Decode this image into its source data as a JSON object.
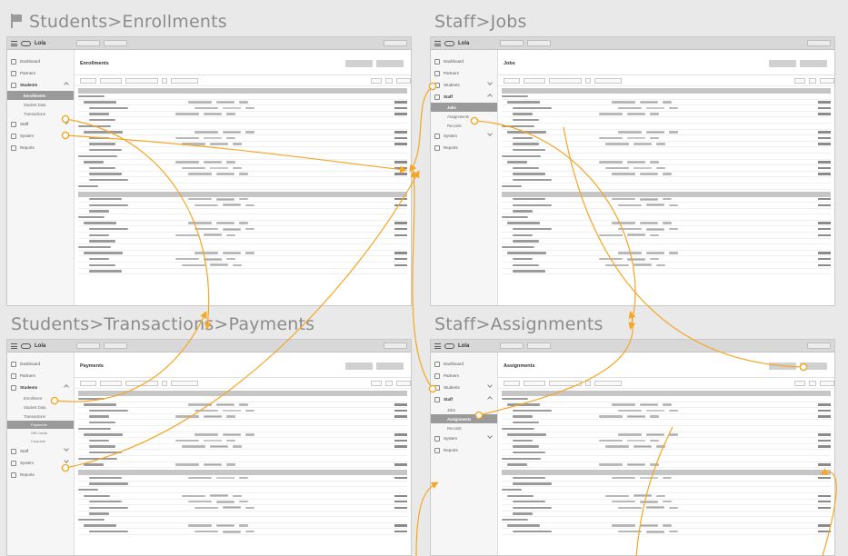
{
  "titles": {
    "enrollments": "Students>Enrollments",
    "jobs": "Staff>Jobs",
    "payments": "Students>Transactions>Payments",
    "assignments": "Staff>Assignments"
  },
  "app": {
    "brand": "Lola"
  },
  "screens": {
    "enrollments": {
      "page_title": "Enrollments",
      "sidebar": [
        {
          "type": "item",
          "label": "Dashboard"
        },
        {
          "type": "item",
          "label": "Partners"
        },
        {
          "type": "item",
          "label": "Students",
          "open": true
        },
        {
          "type": "sub",
          "label": "Enrollments",
          "active": true
        },
        {
          "type": "sub",
          "label": "Student Data"
        },
        {
          "type": "sub",
          "label": "Transactions"
        },
        {
          "type": "item",
          "label": "Staff"
        },
        {
          "type": "item",
          "label": "System"
        },
        {
          "type": "item",
          "label": "Reports"
        }
      ]
    },
    "jobs": {
      "page_title": "Jobs",
      "sidebar": [
        {
          "type": "item",
          "label": "Dashboard"
        },
        {
          "type": "item",
          "label": "Partners"
        },
        {
          "type": "item",
          "label": "Students"
        },
        {
          "type": "item",
          "label": "Staff",
          "open": true
        },
        {
          "type": "sub",
          "label": "Jobs",
          "active": true
        },
        {
          "type": "sub",
          "label": "Assignments"
        },
        {
          "type": "sub",
          "label": "Records"
        },
        {
          "type": "item",
          "label": "System"
        },
        {
          "type": "item",
          "label": "Reports"
        }
      ]
    },
    "payments": {
      "page_title": "Payments",
      "sidebar": [
        {
          "type": "item",
          "label": "Dashboard"
        },
        {
          "type": "item",
          "label": "Partners"
        },
        {
          "type": "item",
          "label": "Students",
          "open": true
        },
        {
          "type": "sub",
          "label": "Enrollment"
        },
        {
          "type": "sub",
          "label": "Student Data"
        },
        {
          "type": "sub",
          "label": "Transactions"
        },
        {
          "type": "subsub",
          "label": "Payments",
          "active": true
        },
        {
          "type": "subsub",
          "label": "Gift Cards"
        },
        {
          "type": "subsub",
          "label": "Coupons"
        },
        {
          "type": "item",
          "label": "Staff"
        },
        {
          "type": "item",
          "label": "System"
        },
        {
          "type": "item",
          "label": "Reports"
        }
      ]
    },
    "assignments": {
      "page_title": "Assignments",
      "sidebar": [
        {
          "type": "item",
          "label": "Dashboard"
        },
        {
          "type": "item",
          "label": "Partners"
        },
        {
          "type": "item",
          "label": "Students"
        },
        {
          "type": "item",
          "label": "Staff",
          "open": true
        },
        {
          "type": "sub",
          "label": "Jobs"
        },
        {
          "type": "sub",
          "label": "Assignments",
          "active": true
        },
        {
          "type": "sub",
          "label": "Records"
        },
        {
          "type": "item",
          "label": "System"
        },
        {
          "type": "item",
          "label": "Reports"
        }
      ]
    }
  },
  "colors": {
    "link": "#f5a623",
    "frame_title": "#8c8c8c",
    "active_nav": "#9a9a9a"
  }
}
